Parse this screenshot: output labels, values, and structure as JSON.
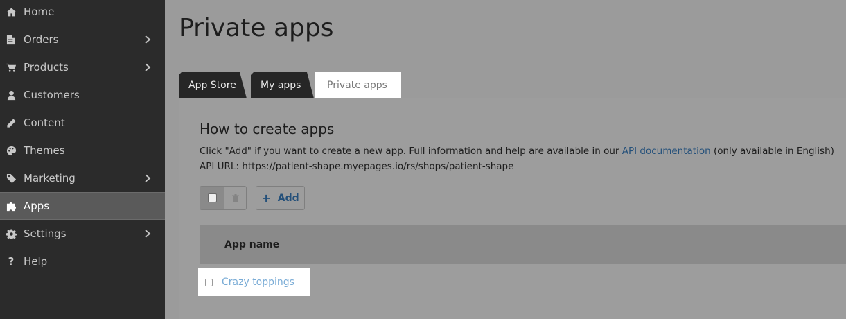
{
  "sidebar": {
    "items": [
      {
        "label": "Home",
        "icon": "home-icon",
        "chevron": false,
        "active": false
      },
      {
        "label": "Orders",
        "icon": "orders-icon",
        "chevron": true,
        "active": false
      },
      {
        "label": "Products",
        "icon": "cart-icon",
        "chevron": true,
        "active": false
      },
      {
        "label": "Customers",
        "icon": "user-icon",
        "chevron": false,
        "active": false
      },
      {
        "label": "Content",
        "icon": "pencil-icon",
        "chevron": false,
        "active": false
      },
      {
        "label": "Themes",
        "icon": "palette-icon",
        "chevron": false,
        "active": false
      },
      {
        "label": "Marketing",
        "icon": "tag-icon",
        "chevron": true,
        "active": false
      },
      {
        "label": "Apps",
        "icon": "puzzle-icon",
        "chevron": false,
        "active": true
      },
      {
        "label": "Settings",
        "icon": "gear-icon",
        "chevron": true,
        "active": false
      },
      {
        "label": "Help",
        "icon": "question-icon",
        "chevron": false,
        "active": false
      }
    ]
  },
  "page": {
    "title": "Private apps"
  },
  "tabs": [
    {
      "label": "App Store",
      "active": false
    },
    {
      "label": "My apps",
      "active": false
    },
    {
      "label": "Private apps",
      "active": true
    }
  ],
  "section": {
    "heading": "How to create apps",
    "info_prefix": "Click \"Add\" if you want to create a new app. Full information and help are available in our ",
    "info_link": "API documentation",
    "info_suffix": " (only available in English)",
    "api_url_line": "API URL: https://patient-shape.myepages.io/rs/shops/patient-shape"
  },
  "toolbar": {
    "add_label": "Add",
    "add_icon": "plus-icon",
    "delete_icon": "trash-icon"
  },
  "table": {
    "columns": [
      "App name"
    ],
    "rows": [
      {
        "name": "Crazy toppings"
      }
    ]
  },
  "colors": {
    "sidebar_bg": "#2b2b2b",
    "link": "#24507a",
    "row_link": "#7aacd6"
  }
}
